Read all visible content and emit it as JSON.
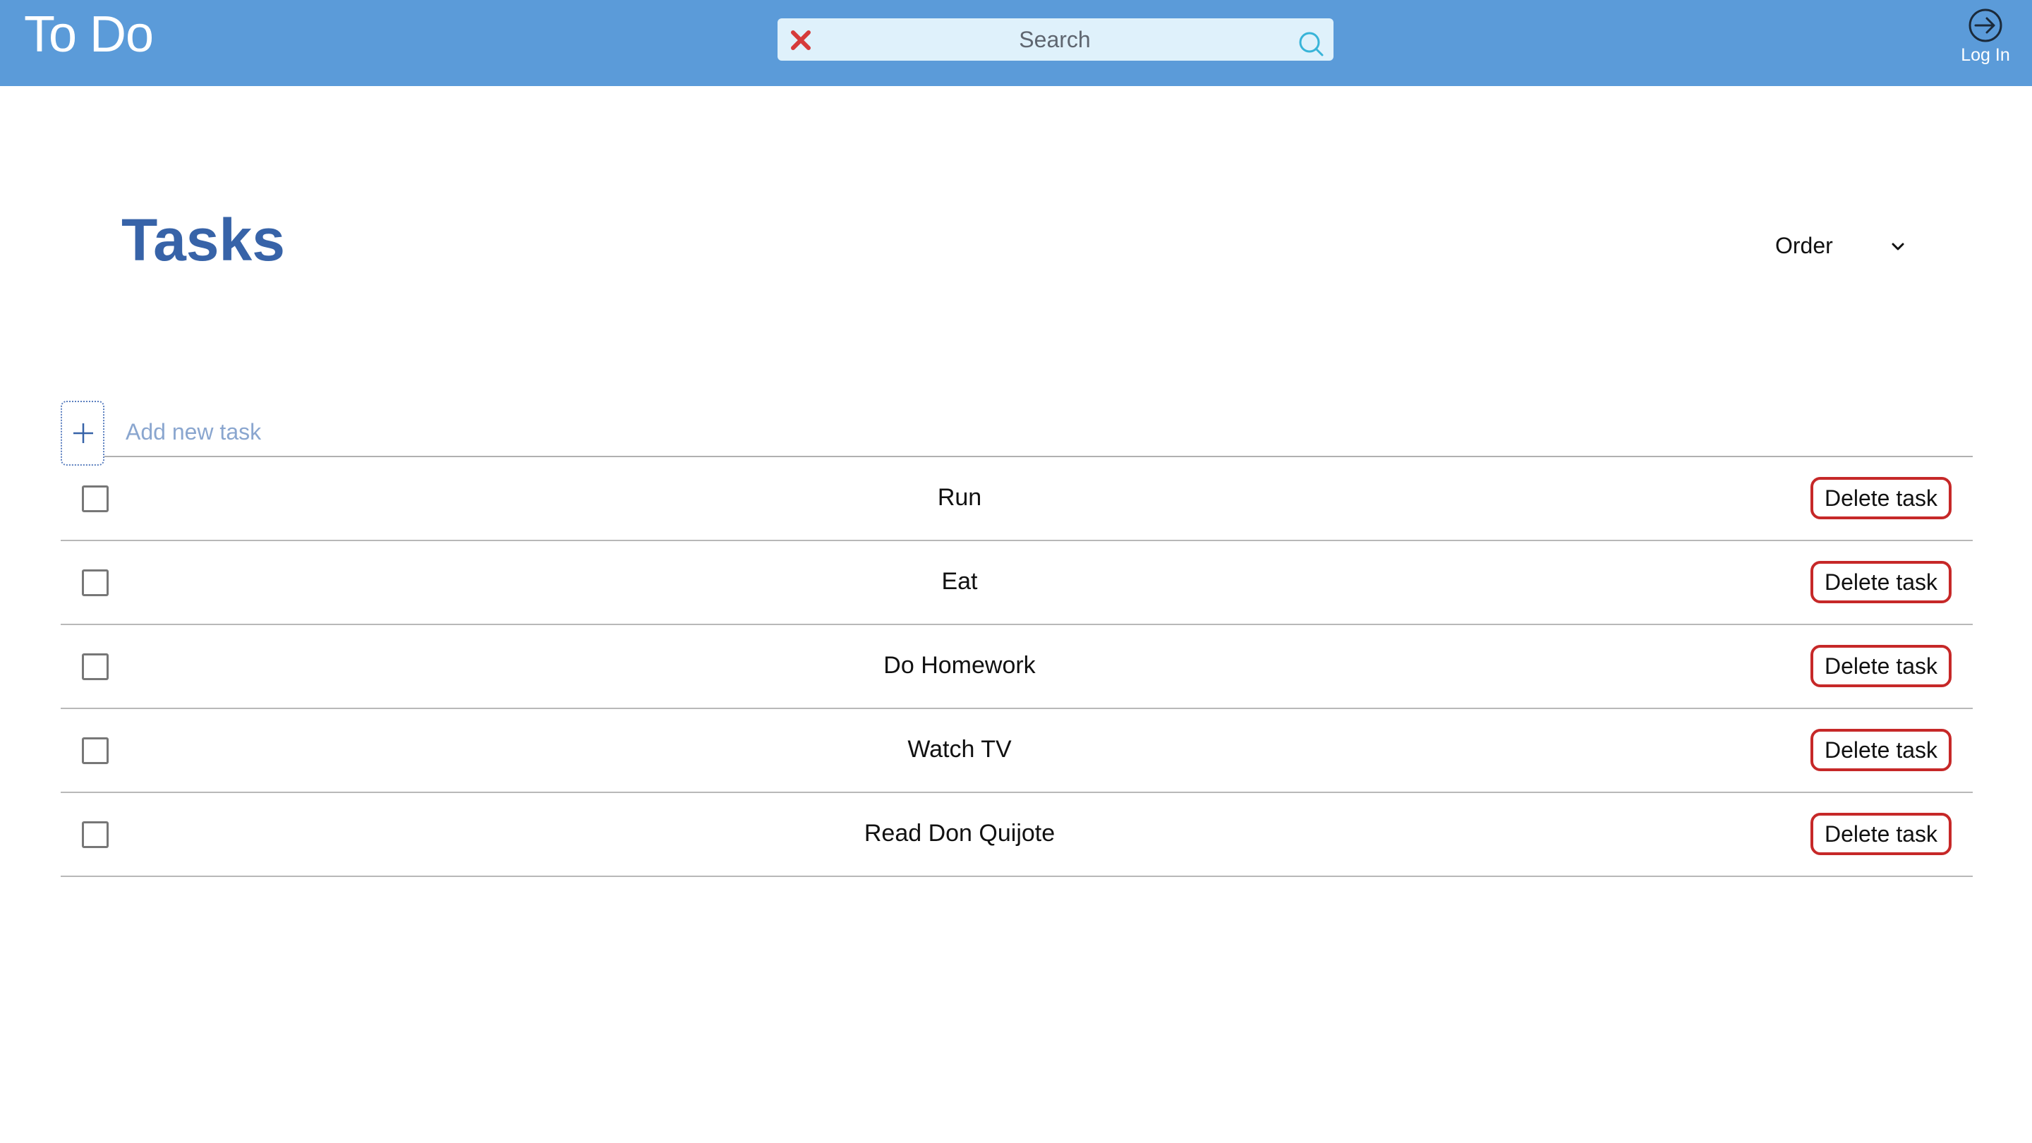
{
  "header": {
    "app_title": "To Do",
    "search": {
      "placeholder": "Search",
      "value": ""
    },
    "login_label": "Log In"
  },
  "main": {
    "title": "Tasks",
    "order_label": "Order",
    "add_task": {
      "placeholder": "Add new task",
      "value": ""
    },
    "delete_label": "Delete task",
    "tasks": [
      {
        "name": "Run",
        "done": false
      },
      {
        "name": "Eat",
        "done": false
      },
      {
        "name": "Do Homework",
        "done": false
      },
      {
        "name": "Watch TV",
        "done": false
      },
      {
        "name": "Read Don Quijote",
        "done": false
      }
    ]
  },
  "icons": {
    "clear": "close-icon",
    "search": "search-icon",
    "login": "login-icon",
    "order": "chevron-down-icon",
    "add": "plus-icon"
  },
  "colors": {
    "header_bg": "#5b9bd9",
    "search_bg": "#dff1fb",
    "title": "#3763a8",
    "delete_border": "#c62828",
    "clear_icon": "#d63a3a"
  }
}
